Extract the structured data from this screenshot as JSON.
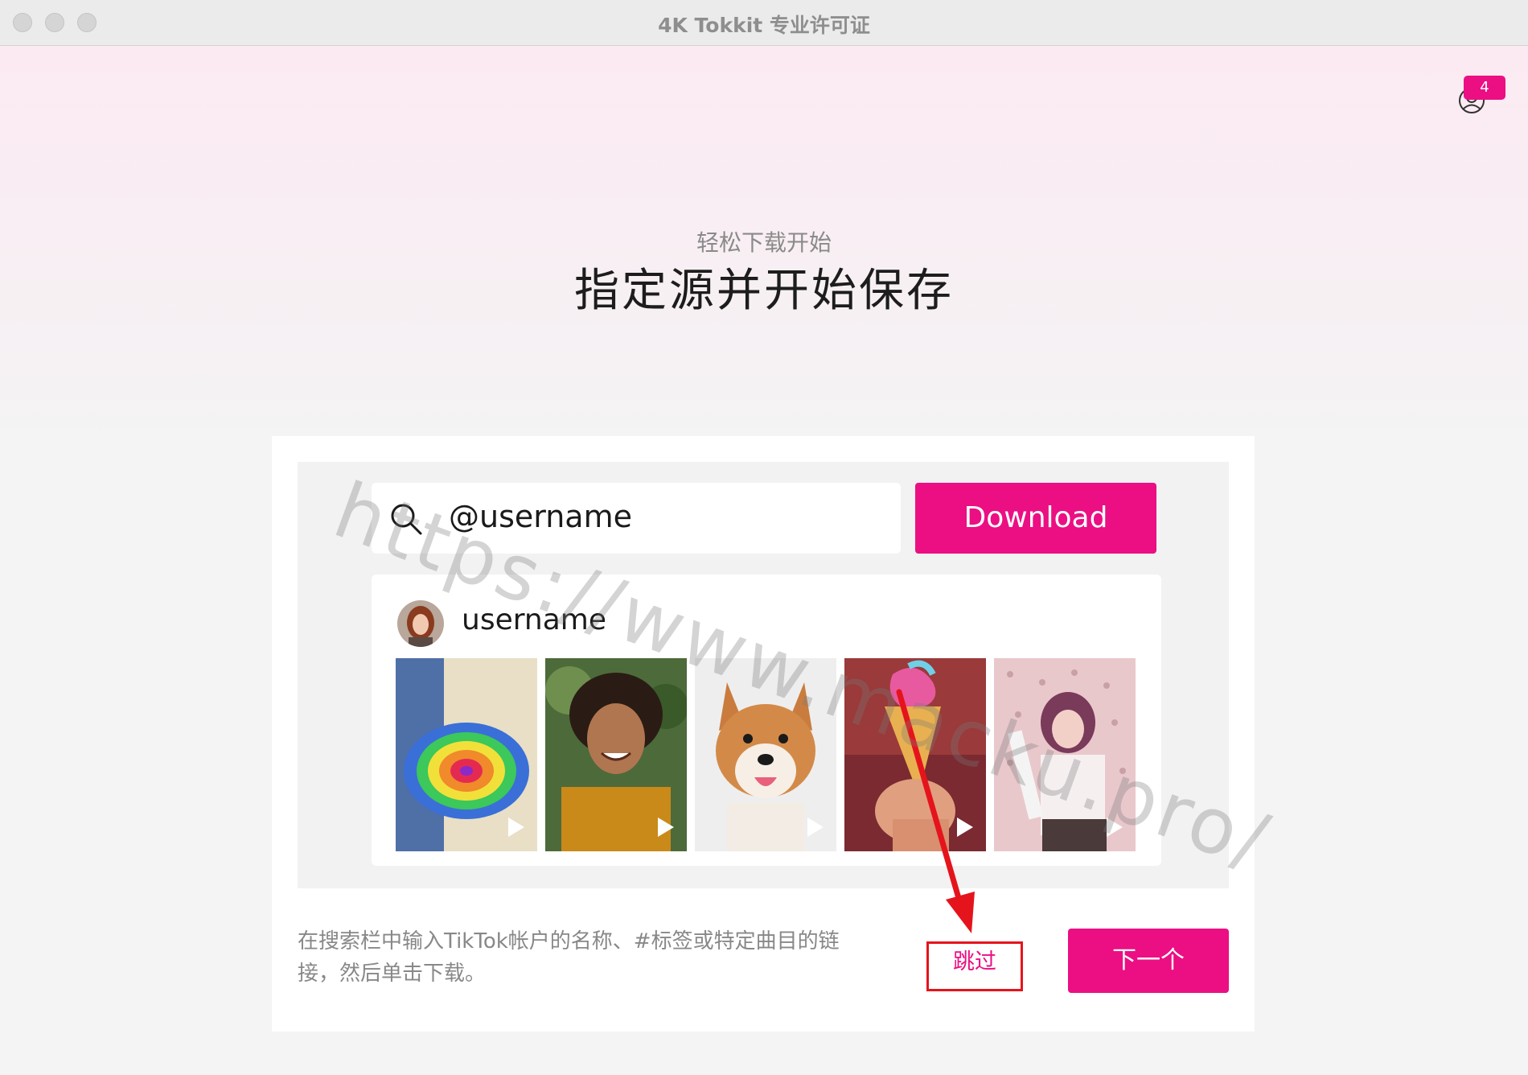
{
  "window": {
    "title": "4K Tokkit 专业许可证"
  },
  "header": {
    "account_badge": "4",
    "account_icon": "user-circle-icon"
  },
  "hero": {
    "subtitle": "轻松下载开始",
    "title": "指定源并开始保存"
  },
  "preview": {
    "search": {
      "value": "@username",
      "icon": "search-icon"
    },
    "download_label": "Download",
    "profile": {
      "name": "username",
      "thumbnails": [
        "rainbow-art-wall",
        "smiling-person",
        "shiba-dog",
        "ice-cream-cone",
        "person-with-bat"
      ]
    }
  },
  "footer": {
    "help_text": "在搜索栏中输入TikTok帐户的名称、#标签或特定曲目的链接，然后单击下载。",
    "skip_label": "跳过",
    "next_label": "下一个"
  },
  "annotation": {
    "color": "#e5141c"
  },
  "watermark": "https://www.macku.pro/",
  "colors": {
    "accent": "#eb0f83",
    "annotation": "#e5141c"
  }
}
